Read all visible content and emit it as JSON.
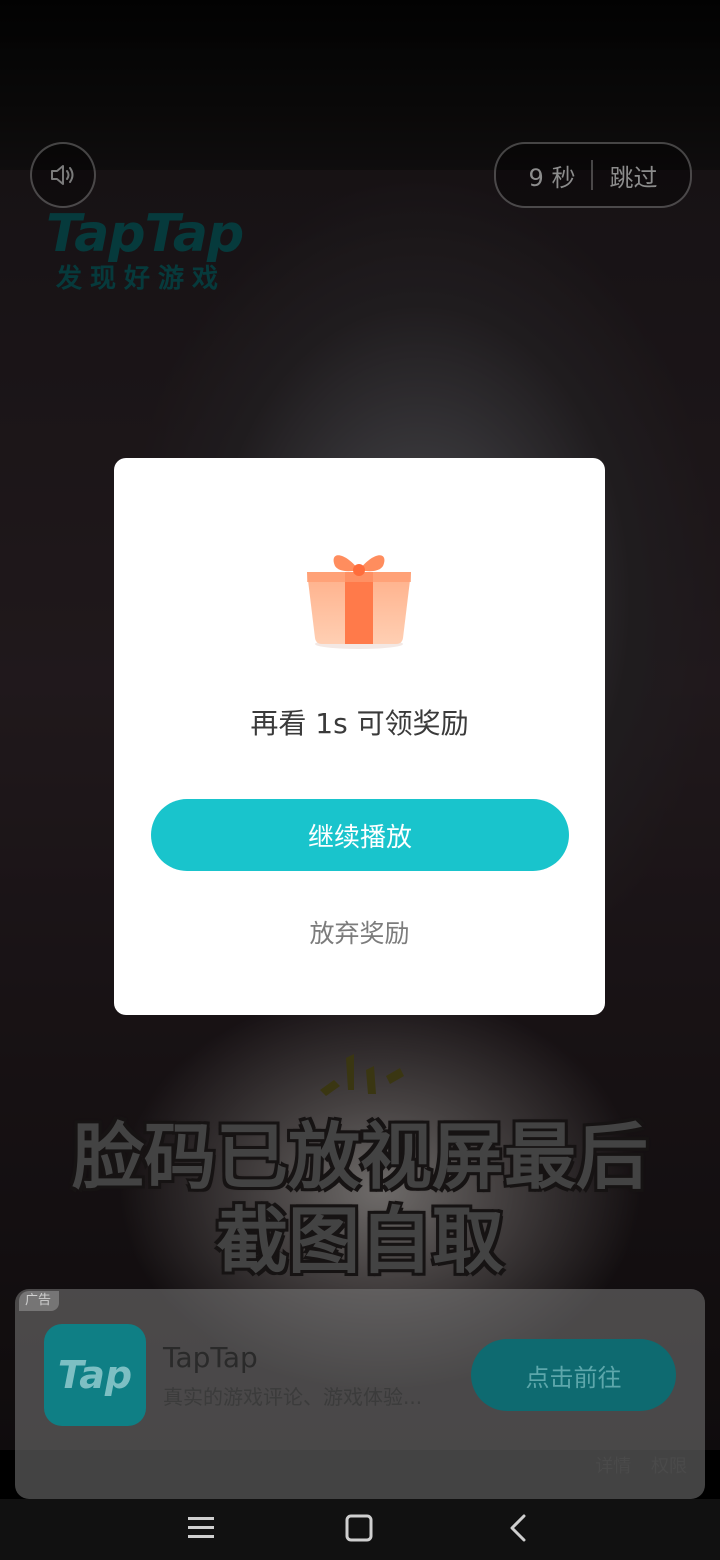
{
  "top_controls": {
    "countdown": "9 秒",
    "skip_label": "跳过",
    "sound_icon": "speaker-icon"
  },
  "logo": {
    "main": "TapTap",
    "sub": "发现好游戏"
  },
  "video_caption": {
    "line1": "脸码已放视屏最后",
    "line2": "截图自取"
  },
  "dialog": {
    "icon": "gift-icon",
    "message": "再看 1s 可领奖励",
    "continue_label": "继续播放",
    "giveup_label": "放弃奖励"
  },
  "ad_card": {
    "badge": "广告",
    "app_icon_text": "Tap",
    "app_name": "TapTap",
    "app_desc": "真实的游戏评论、游戏体验...",
    "cta_label": "点击前往",
    "details_label": "详情",
    "permissions_label": "权限"
  },
  "navbar": {
    "menu_icon": "menu-icon",
    "home_icon": "home-square-icon",
    "back_icon": "back-chevron-icon"
  },
  "colors": {
    "accent": "#19c4cc",
    "dialog_bg": "#ffffff",
    "gift_orange": "#ff7d4f"
  }
}
